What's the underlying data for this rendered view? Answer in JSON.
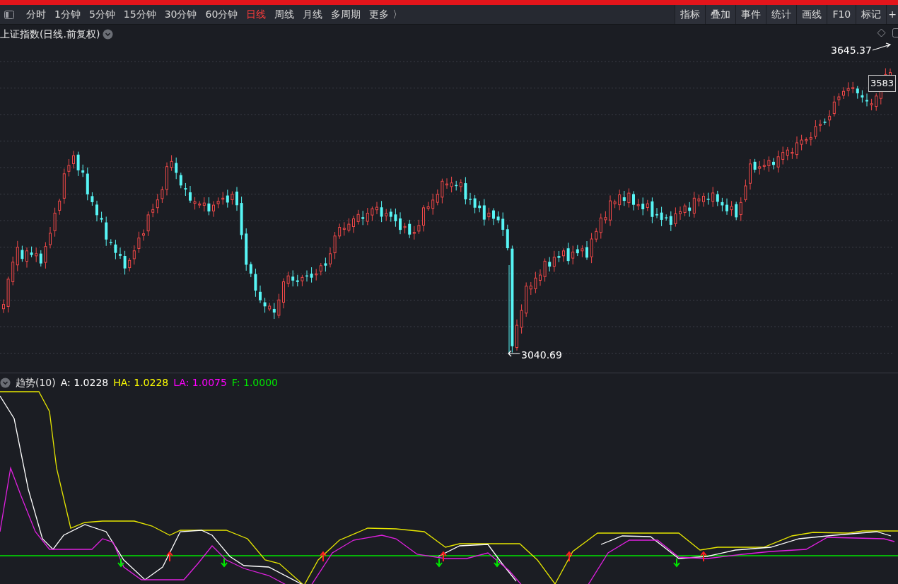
{
  "toolbar": {
    "periods": [
      {
        "label": "分时",
        "selected": false
      },
      {
        "label": "1分钟",
        "selected": false
      },
      {
        "label": "5分钟",
        "selected": false
      },
      {
        "label": "15分钟",
        "selected": false
      },
      {
        "label": "30分钟",
        "selected": false
      },
      {
        "label": "60分钟",
        "selected": false
      },
      {
        "label": "日线",
        "selected": true
      },
      {
        "label": "周线",
        "selected": false
      },
      {
        "label": "月线",
        "selected": false
      },
      {
        "label": "多周期",
        "selected": false
      },
      {
        "label": "更多 〉",
        "selected": false
      }
    ],
    "tools": [
      "指标",
      "叠加",
      "事件",
      "统计",
      "画线",
      "F10",
      "标记",
      "+"
    ]
  },
  "chart": {
    "title": "上证指数(日线.前复权)",
    "high_label": "3645.37",
    "last_price_label": "3583",
    "low_label": "3040.69"
  },
  "indicator": {
    "name": "趋势(10)",
    "values": [
      {
        "text": "A: 1.0228",
        "color": "#ffffff"
      },
      {
        "text": "HA: 1.0228",
        "color": "#ffff00"
      },
      {
        "text": "LA: 1.0075",
        "color": "#ff00ff"
      },
      {
        "text": "F: 1.0000",
        "color": "#00e600"
      }
    ]
  }
}
